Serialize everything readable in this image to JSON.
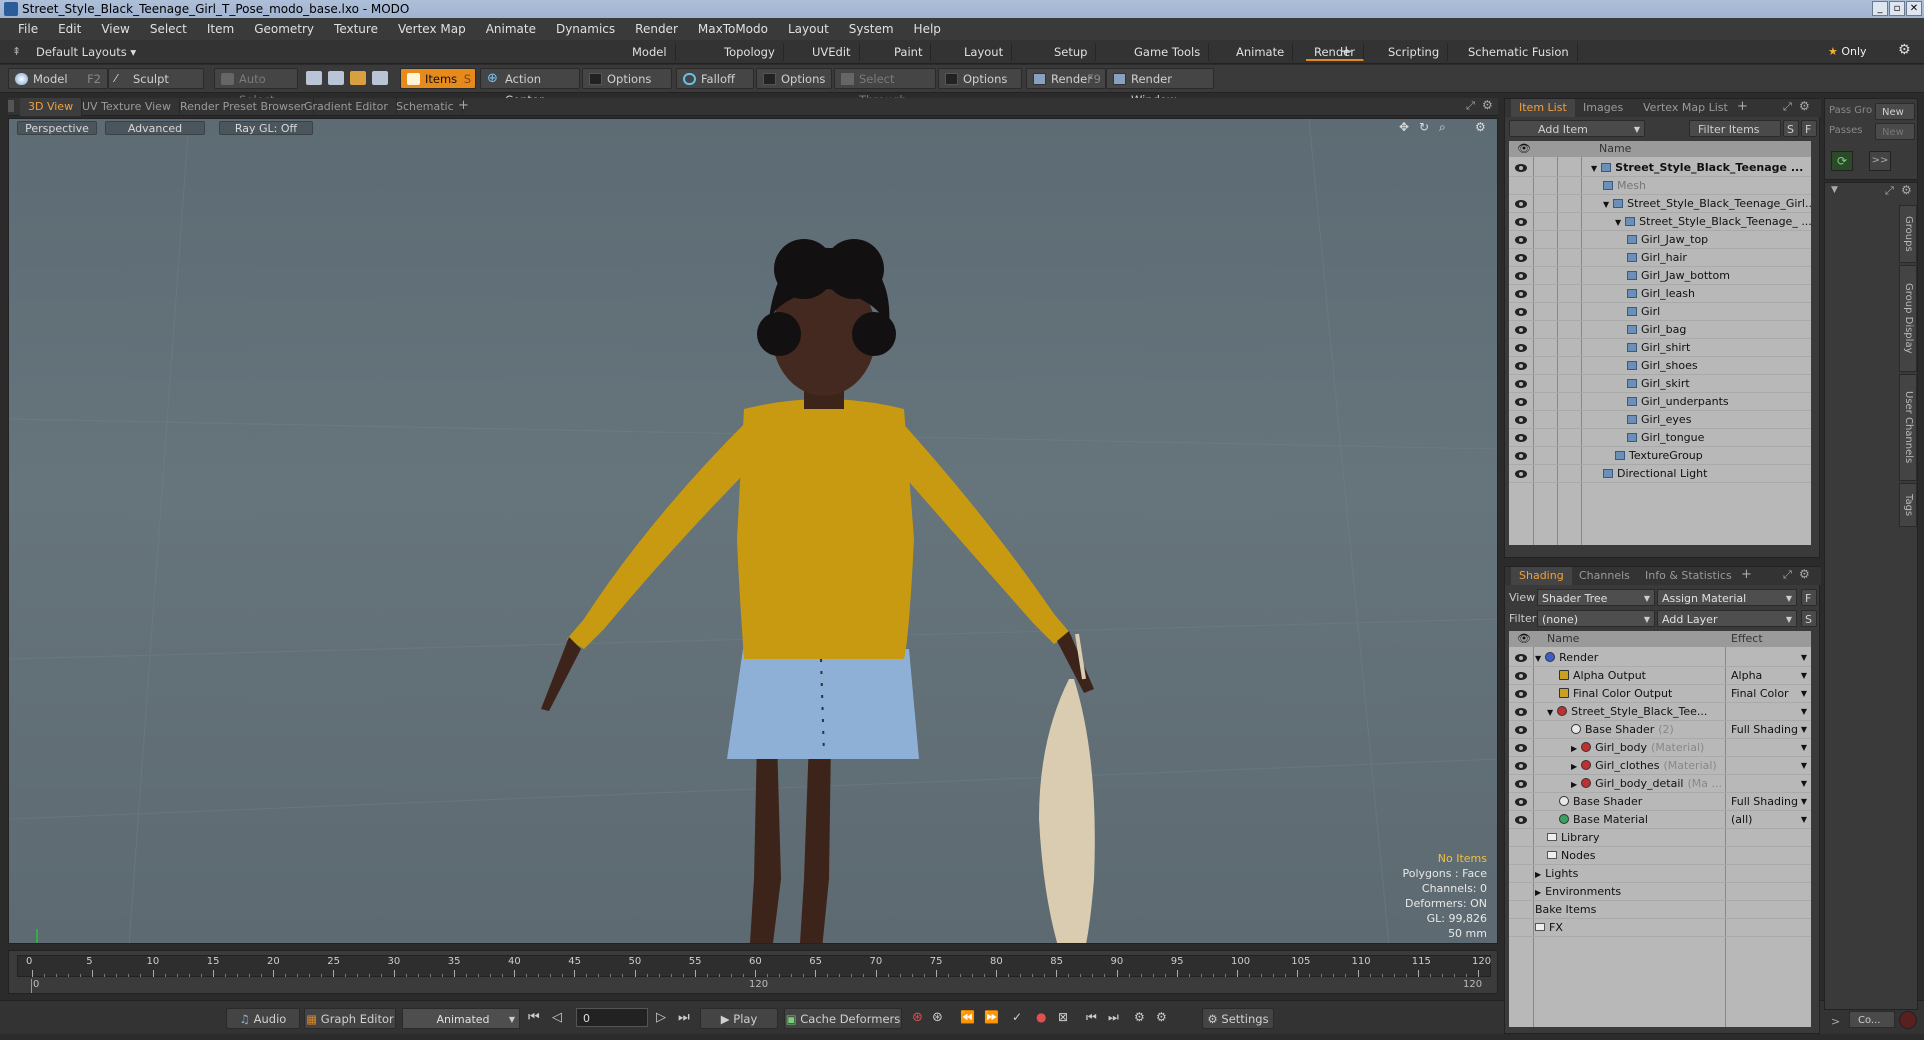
{
  "window": {
    "title": "Street_Style_Black_Teenage_Girl_T_Pose_modo_base.lxo - MODO"
  },
  "menu": [
    "File",
    "Edit",
    "View",
    "Select",
    "Item",
    "Geometry",
    "Texture",
    "Vertex Map",
    "Animate",
    "Dynamics",
    "Render",
    "MaxToModo",
    "Layout",
    "System",
    "Help"
  ],
  "layouts": {
    "current": "Default Layouts",
    "tabs": [
      "Model",
      "Topology",
      "UVEdit",
      "Paint",
      "Layout",
      "Setup",
      "Game Tools",
      "Animate",
      "Render",
      "Scripting",
      "Schematic Fusion"
    ],
    "active": "Render",
    "only": "Only",
    "plus": "+"
  },
  "toolbar": {
    "model": "Model",
    "model_key": "F2",
    "sculpt": "Sculpt",
    "auto_select": "Auto Select",
    "items": "Items",
    "items_key": "S",
    "action_center": "Action Center",
    "options1": "Options",
    "falloff": "Falloff",
    "options2": "Options",
    "select_through": "Select Through",
    "options3": "Options",
    "render": "Render",
    "render_key": "F9",
    "render_window": "Render Window"
  },
  "viewport_tabs": [
    "3D View",
    "UV Texture View",
    "Render Preset Browser",
    "Gradient Editor",
    "Schematic"
  ],
  "viewport": {
    "perspective": "Perspective",
    "advanced": "Advanced",
    "raygl": "Ray GL: Off",
    "hud": {
      "no_items": "No Items",
      "polygons": "Polygons : Face",
      "channels": "Channels: 0",
      "deformers": "Deformers: ON",
      "gl": "GL: 99,826",
      "focal": "50 mm"
    }
  },
  "timeline": {
    "ticks": [
      0,
      5,
      10,
      15,
      20,
      25,
      30,
      35,
      40,
      45,
      50,
      55,
      60,
      65,
      70,
      75,
      80,
      85,
      90,
      95,
      100,
      105,
      110,
      115,
      120
    ],
    "start": "0",
    "mid": "120",
    "end": "120"
  },
  "bottom": {
    "audio": "Audio",
    "graph_editor": "Graph Editor",
    "animated": "Animated",
    "frame": "0",
    "play": "Play",
    "cache_deformers": "Cache Deformers",
    "settings": "Settings"
  },
  "item_list": {
    "tabs": [
      "Item List",
      "Images",
      "Vertex Map List"
    ],
    "add_item": "Add Item",
    "filter_items": "Filter Items",
    "s": "S",
    "f": "F",
    "header_name": "Name",
    "rows": [
      {
        "label": "Street_Style_Black_Teenage ...",
        "indent": 0,
        "bold": true,
        "arrow": "▼",
        "eye": true
      },
      {
        "label": "Mesh",
        "indent": 1,
        "dim": true,
        "eye": false
      },
      {
        "label": "Street_Style_Black_Teenage_Girl...",
        "indent": 1,
        "arrow": "▼",
        "eye": true
      },
      {
        "label": "Street_Style_Black_Teenage_ ...",
        "indent": 2,
        "arrow": "▼",
        "eye": true
      },
      {
        "label": "Girl_Jaw_top",
        "indent": 3,
        "eye": true
      },
      {
        "label": "Girl_hair",
        "indent": 3,
        "eye": true
      },
      {
        "label": "Girl_Jaw_bottom",
        "indent": 3,
        "eye": true
      },
      {
        "label": "Girl_leash",
        "indent": 3,
        "eye": true
      },
      {
        "label": "Girl",
        "indent": 3,
        "eye": true
      },
      {
        "label": "Girl_bag",
        "indent": 3,
        "eye": true
      },
      {
        "label": "Girl_shirt",
        "indent": 3,
        "eye": true
      },
      {
        "label": "Girl_shoes",
        "indent": 3,
        "eye": true
      },
      {
        "label": "Girl_skirt",
        "indent": 3,
        "eye": true
      },
      {
        "label": "Girl_underpants",
        "indent": 3,
        "eye": true
      },
      {
        "label": "Girl_eyes",
        "indent": 3,
        "eye": true
      },
      {
        "label": "Girl_tongue",
        "indent": 3,
        "eye": true
      },
      {
        "label": "TextureGroup",
        "indent": 2,
        "eye": true
      },
      {
        "label": "Directional Light",
        "indent": 1,
        "eye": true
      }
    ]
  },
  "pass": {
    "pass_groups": "Pass Gro",
    "passes": "Passes",
    "new1": "New",
    "new2": "New"
  },
  "side_tabs": [
    "Groups",
    "Group Display",
    "User Channels",
    "Tags"
  ],
  "shading": {
    "tabs": [
      "Shading",
      "Channels",
      "Info & Statistics"
    ],
    "view_label": "View",
    "view_value": "Shader Tree",
    "assign_material": "Assign Material",
    "f": "F",
    "filter_label": "Filter",
    "filter_value": "(none)",
    "add_layer": "Add Layer",
    "s": "S",
    "col_name": "Name",
    "col_effect": "Effect",
    "rows": [
      {
        "label": "Render",
        "indent": 0,
        "arrow": "▼",
        "effect": "",
        "color": "#3a5fc8",
        "eye": true
      },
      {
        "label": "Alpha Output",
        "indent": 2,
        "effect": "Alpha",
        "color": "#c9a020",
        "eye": true,
        "sq": true
      },
      {
        "label": "Final Color Output",
        "indent": 2,
        "effect": "Final Color",
        "color": "#c9a020",
        "eye": true,
        "sq": true
      },
      {
        "label": "Street_Style_Black_Tee...",
        "indent": 1,
        "arrow": "▼",
        "effect": "",
        "color": "#c03030",
        "eye": true
      },
      {
        "label": "Base Shader",
        "sub": "(2)",
        "indent": 3,
        "effect": "Full Shading",
        "color": "#e8e8e8",
        "eye": true
      },
      {
        "label": "Girl_body",
        "sub": "(Material)",
        "indent": 3,
        "arrow": "▶",
        "effect": "",
        "color": "#c03030",
        "eye": true
      },
      {
        "label": "Girl_clothes",
        "sub": "(Material)",
        "indent": 3,
        "arrow": "▶",
        "effect": "",
        "color": "#c03030",
        "eye": true
      },
      {
        "label": "Girl_body_detail",
        "sub": "(Ma ...",
        "indent": 3,
        "arrow": "▶",
        "effect": "",
        "color": "#c03030",
        "eye": true
      },
      {
        "label": "Base Shader",
        "indent": 2,
        "effect": "Full Shading",
        "color": "#e8e8e8",
        "eye": true
      },
      {
        "label": "Base Material",
        "indent": 2,
        "effect": "(all)",
        "color": "#3aa060",
        "eye": true
      },
      {
        "label": "Library",
        "indent": 1,
        "effect": "",
        "color": "",
        "eye": false,
        "folder": true
      },
      {
        "label": "Nodes",
        "indent": 1,
        "effect": "",
        "color": "",
        "eye": false,
        "folder": true
      },
      {
        "label": "Lights",
        "indent": 0,
        "arrow": "▶",
        "effect": "",
        "color": "",
        "eye": false
      },
      {
        "label": "Environments",
        "indent": 0,
        "arrow": "▶",
        "effect": "",
        "color": "",
        "eye": false
      },
      {
        "label": "Bake Items",
        "indent": 0,
        "effect": "",
        "color": "",
        "eye": false
      },
      {
        "label": "FX",
        "indent": 0,
        "effect": "",
        "color": "",
        "eye": false,
        "folder": true
      }
    ]
  },
  "colors": {
    "accent": "#e68a1c",
    "viewport_bg": "#627078",
    "sweater": "#c79a12",
    "skirt": "#8fb0d6",
    "skin": "#4a2d22",
    "bag": "#d9ccb0"
  },
  "misc": {
    "co": "Co..."
  }
}
